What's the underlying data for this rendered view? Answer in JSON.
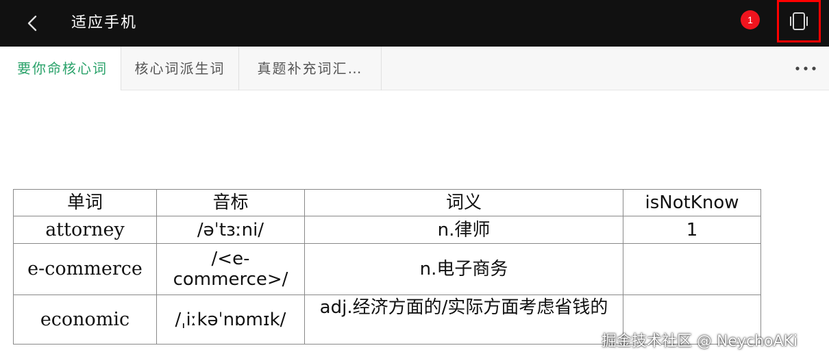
{
  "header": {
    "title": "适应手机",
    "badge_count": "1",
    "colors": {
      "bar": "#111111",
      "badge": "#f0141e",
      "highlight": "#ff0000"
    }
  },
  "tabs": [
    {
      "label": "要你命核心词",
      "active": true
    },
    {
      "label": "核心词派生词",
      "active": false
    },
    {
      "label": "真题补充词汇…",
      "active": false
    }
  ],
  "tab_colors": {
    "active": "#2aa26a",
    "inactive": "#555555"
  },
  "table": {
    "headers": [
      "单词",
      "音标",
      "词义",
      "isNotKnow"
    ],
    "rows": [
      {
        "word": "attorney",
        "phonetic": "/əˈtɜːni/",
        "meaning": "n.律师",
        "isNotKnow": "1"
      },
      {
        "word": "e-commerce",
        "phonetic": "/<e-commerce>/",
        "meaning": "n.电子商务",
        "isNotKnow": ""
      },
      {
        "word": "economic",
        "phonetic": "/ˌiːkəˈnɒmɪk/",
        "meaning": "adj.经济方面的/实际方面考虑省钱的",
        "isNotKnow": ""
      }
    ]
  },
  "watermark": "掘金技术社区 @ NeychoAKi"
}
